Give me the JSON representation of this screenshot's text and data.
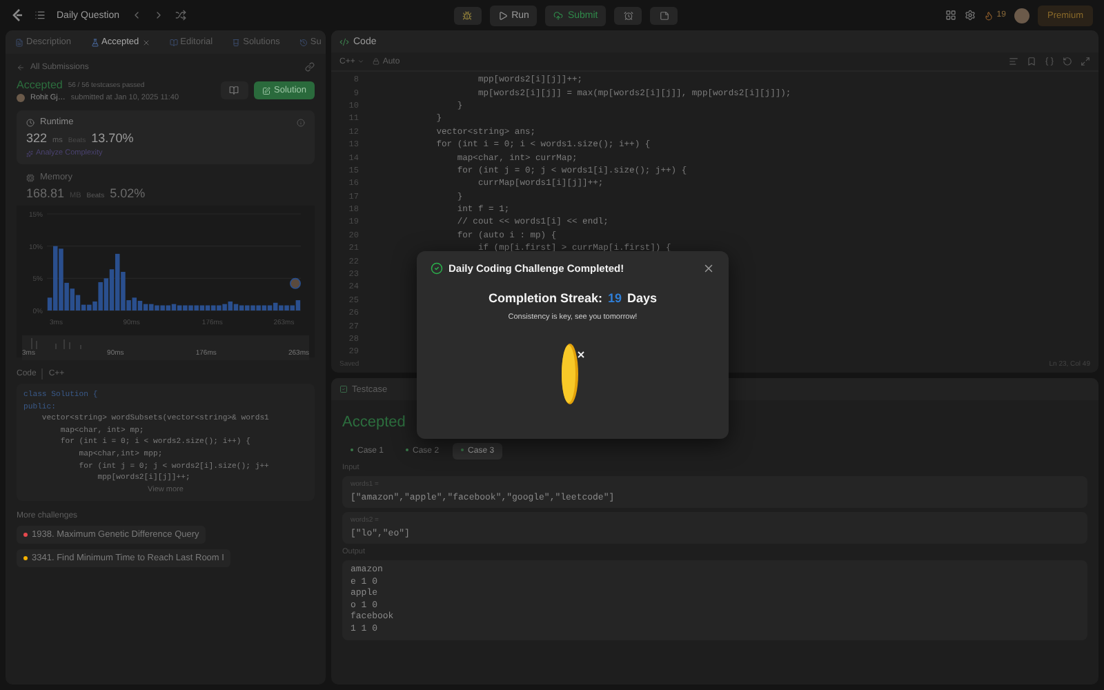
{
  "topbar": {
    "title": "Daily Question",
    "run": "Run",
    "submit": "Submit",
    "streak": "19",
    "premium": "Premium"
  },
  "left": {
    "tabs": [
      {
        "label": "Description",
        "selected": false,
        "closable": false
      },
      {
        "label": "Accepted",
        "selected": true,
        "closable": true
      },
      {
        "label": "Editorial",
        "selected": false,
        "closable": false
      },
      {
        "label": "Solutions",
        "selected": false,
        "closable": false
      },
      {
        "label": "Su",
        "selected": false,
        "closable": false
      }
    ],
    "back": "All Submissions",
    "submission": {
      "status": "Accepted",
      "passed": "56 / 56 testcases passed",
      "user": "Rohit Gj…",
      "submitted": "submitted at Jan 10, 2025 11:40",
      "solution_button": "Solution"
    },
    "runtime": {
      "label": "Runtime",
      "value": "322",
      "unit": "ms",
      "beats_label": "Beats",
      "beats": "13.70%",
      "analyze": "Analyze Complexity"
    },
    "memory": {
      "label": "Memory",
      "value": "168.81",
      "unit": "MB",
      "beats_label": "Beats",
      "beats": "5.02%"
    },
    "chart_data": {
      "type": "bar",
      "x": [
        3,
        9,
        15,
        21,
        27,
        33,
        39,
        45,
        51,
        57,
        63,
        69,
        75,
        81,
        87,
        93,
        99,
        105,
        111,
        117,
        123,
        129,
        135,
        141,
        147,
        153,
        159,
        165,
        171,
        177,
        183,
        189,
        195,
        201,
        207,
        213,
        219,
        225,
        231,
        237,
        243,
        249,
        255,
        261,
        267
      ],
      "values": [
        2,
        10,
        9.6,
        4.3,
        3.4,
        2.4,
        0.9,
        0.9,
        1.4,
        4.4,
        5,
        6.4,
        8.8,
        6,
        1.6,
        2,
        1.5,
        1,
        1,
        0.8,
        0.8,
        0.8,
        1,
        0.8,
        0.8,
        0.8,
        0.8,
        0.8,
        0.8,
        0.8,
        0.8,
        1,
        1.4,
        1,
        0.8,
        0.8,
        0.8,
        0.8,
        0.8,
        0.8,
        1.2,
        0.8,
        0.8,
        0.8,
        1.6
      ],
      "xlim": [
        0,
        270
      ],
      "ylim": [
        0,
        15
      ],
      "xticks": [
        {
          "value": 3,
          "label": "3ms"
        },
        {
          "value": 90,
          "label": "90ms"
        },
        {
          "value": 176,
          "label": "176ms"
        },
        {
          "value": 263,
          "label": "263ms"
        }
      ],
      "yticks": [
        {
          "value": 0,
          "label": "0%"
        },
        {
          "value": 5,
          "label": "5%"
        },
        {
          "value": 10,
          "label": "10%"
        },
        {
          "value": 15,
          "label": "15%"
        }
      ]
    },
    "overview_labels": [
      "3ms",
      "90ms",
      "176ms",
      "263ms"
    ],
    "code_label": "Code",
    "language": "C++",
    "code": [
      "class Solution {",
      "public:",
      "    vector<string> wordSubsets(vector<string>& words1",
      "        map<char, int> mp;",
      "        for (int i = 0; i < words2.size(); i++) {",
      "            map<char,int> mpp;",
      "            for (int j = 0; j < words2[i].size(); j++",
      "                mpp[words2[i][j]]++;"
    ],
    "view_more": "View more",
    "more_title": "More challenges",
    "challenges": [
      {
        "title": "1938. Maximum Genetic Difference Query",
        "color": "#e5484d"
      },
      {
        "title": "3341. Find Minimum Time to Reach Last Room I",
        "color": "#f5b100"
      }
    ]
  },
  "editor": {
    "tab": "Code",
    "language": "C++",
    "mode": "Auto",
    "lines": [
      {
        "number": "8",
        "text": "                mpp[words2[i][j]]++;"
      },
      {
        "number": "9",
        "text": "                mp[words2[i][j]] = max(mp[words2[i][j]], mpp[words2[i][j]]);"
      },
      {
        "number": "10",
        "text": "            }"
      },
      {
        "number": "11",
        "text": "        }"
      },
      {
        "number": "12",
        "text": "        vector<string> ans;"
      },
      {
        "number": "13",
        "text": "        for (int i = 0; i < words1.size(); i++) {"
      },
      {
        "number": "14",
        "text": "            map<char, int> currMap;"
      },
      {
        "number": "15",
        "text": "            for (int j = 0; j < words1[i].size(); j++) {"
      },
      {
        "number": "16",
        "text": "                currMap[words1[i][j]]++;"
      },
      {
        "number": "17",
        "text": "            }"
      },
      {
        "number": "18",
        "text": "            int f = 1;"
      },
      {
        "number": "19",
        "text": "            // cout << words1[i] << endl;"
      },
      {
        "number": "20",
        "text": "            for (auto i : mp) {"
      },
      {
        "number": "21",
        "text": "                if (mp[i.first] > currMap[i.first]) {"
      },
      {
        "number": "22"
      },
      {
        "number": "23"
      },
      {
        "number": "24"
      },
      {
        "number": "25"
      },
      {
        "number": "26"
      },
      {
        "number": "27"
      },
      {
        "number": "28"
      },
      {
        "number": "29"
      }
    ],
    "saved": "Saved",
    "cursor": "Ln 23, Col 49"
  },
  "testcase": {
    "tab": "Testcase",
    "status": "Accepted",
    "cases": [
      {
        "label": "Case 1",
        "selected": false
      },
      {
        "label": "Case 2",
        "selected": false
      },
      {
        "label": "Case 3",
        "selected": true
      }
    ],
    "input_label": "Input",
    "inputs": [
      {
        "name": "words1 =",
        "value": "[\"amazon\",\"apple\",\"facebook\",\"google\",\"leetcode\"]"
      },
      {
        "name": "words2 =",
        "value": "[\"lo\",\"eo\"]"
      }
    ],
    "output_label": "Output",
    "output": [
      "amazon",
      "e 1 0",
      "apple",
      "o 1 0",
      "facebook",
      "1 1 0"
    ]
  },
  "modal": {
    "title": "Daily Coding Challenge Completed!",
    "streak_label": "Completion Streak:",
    "streak": "19",
    "streak_unit": "Days",
    "message": "Consistency is key, see you tomorrow!"
  }
}
